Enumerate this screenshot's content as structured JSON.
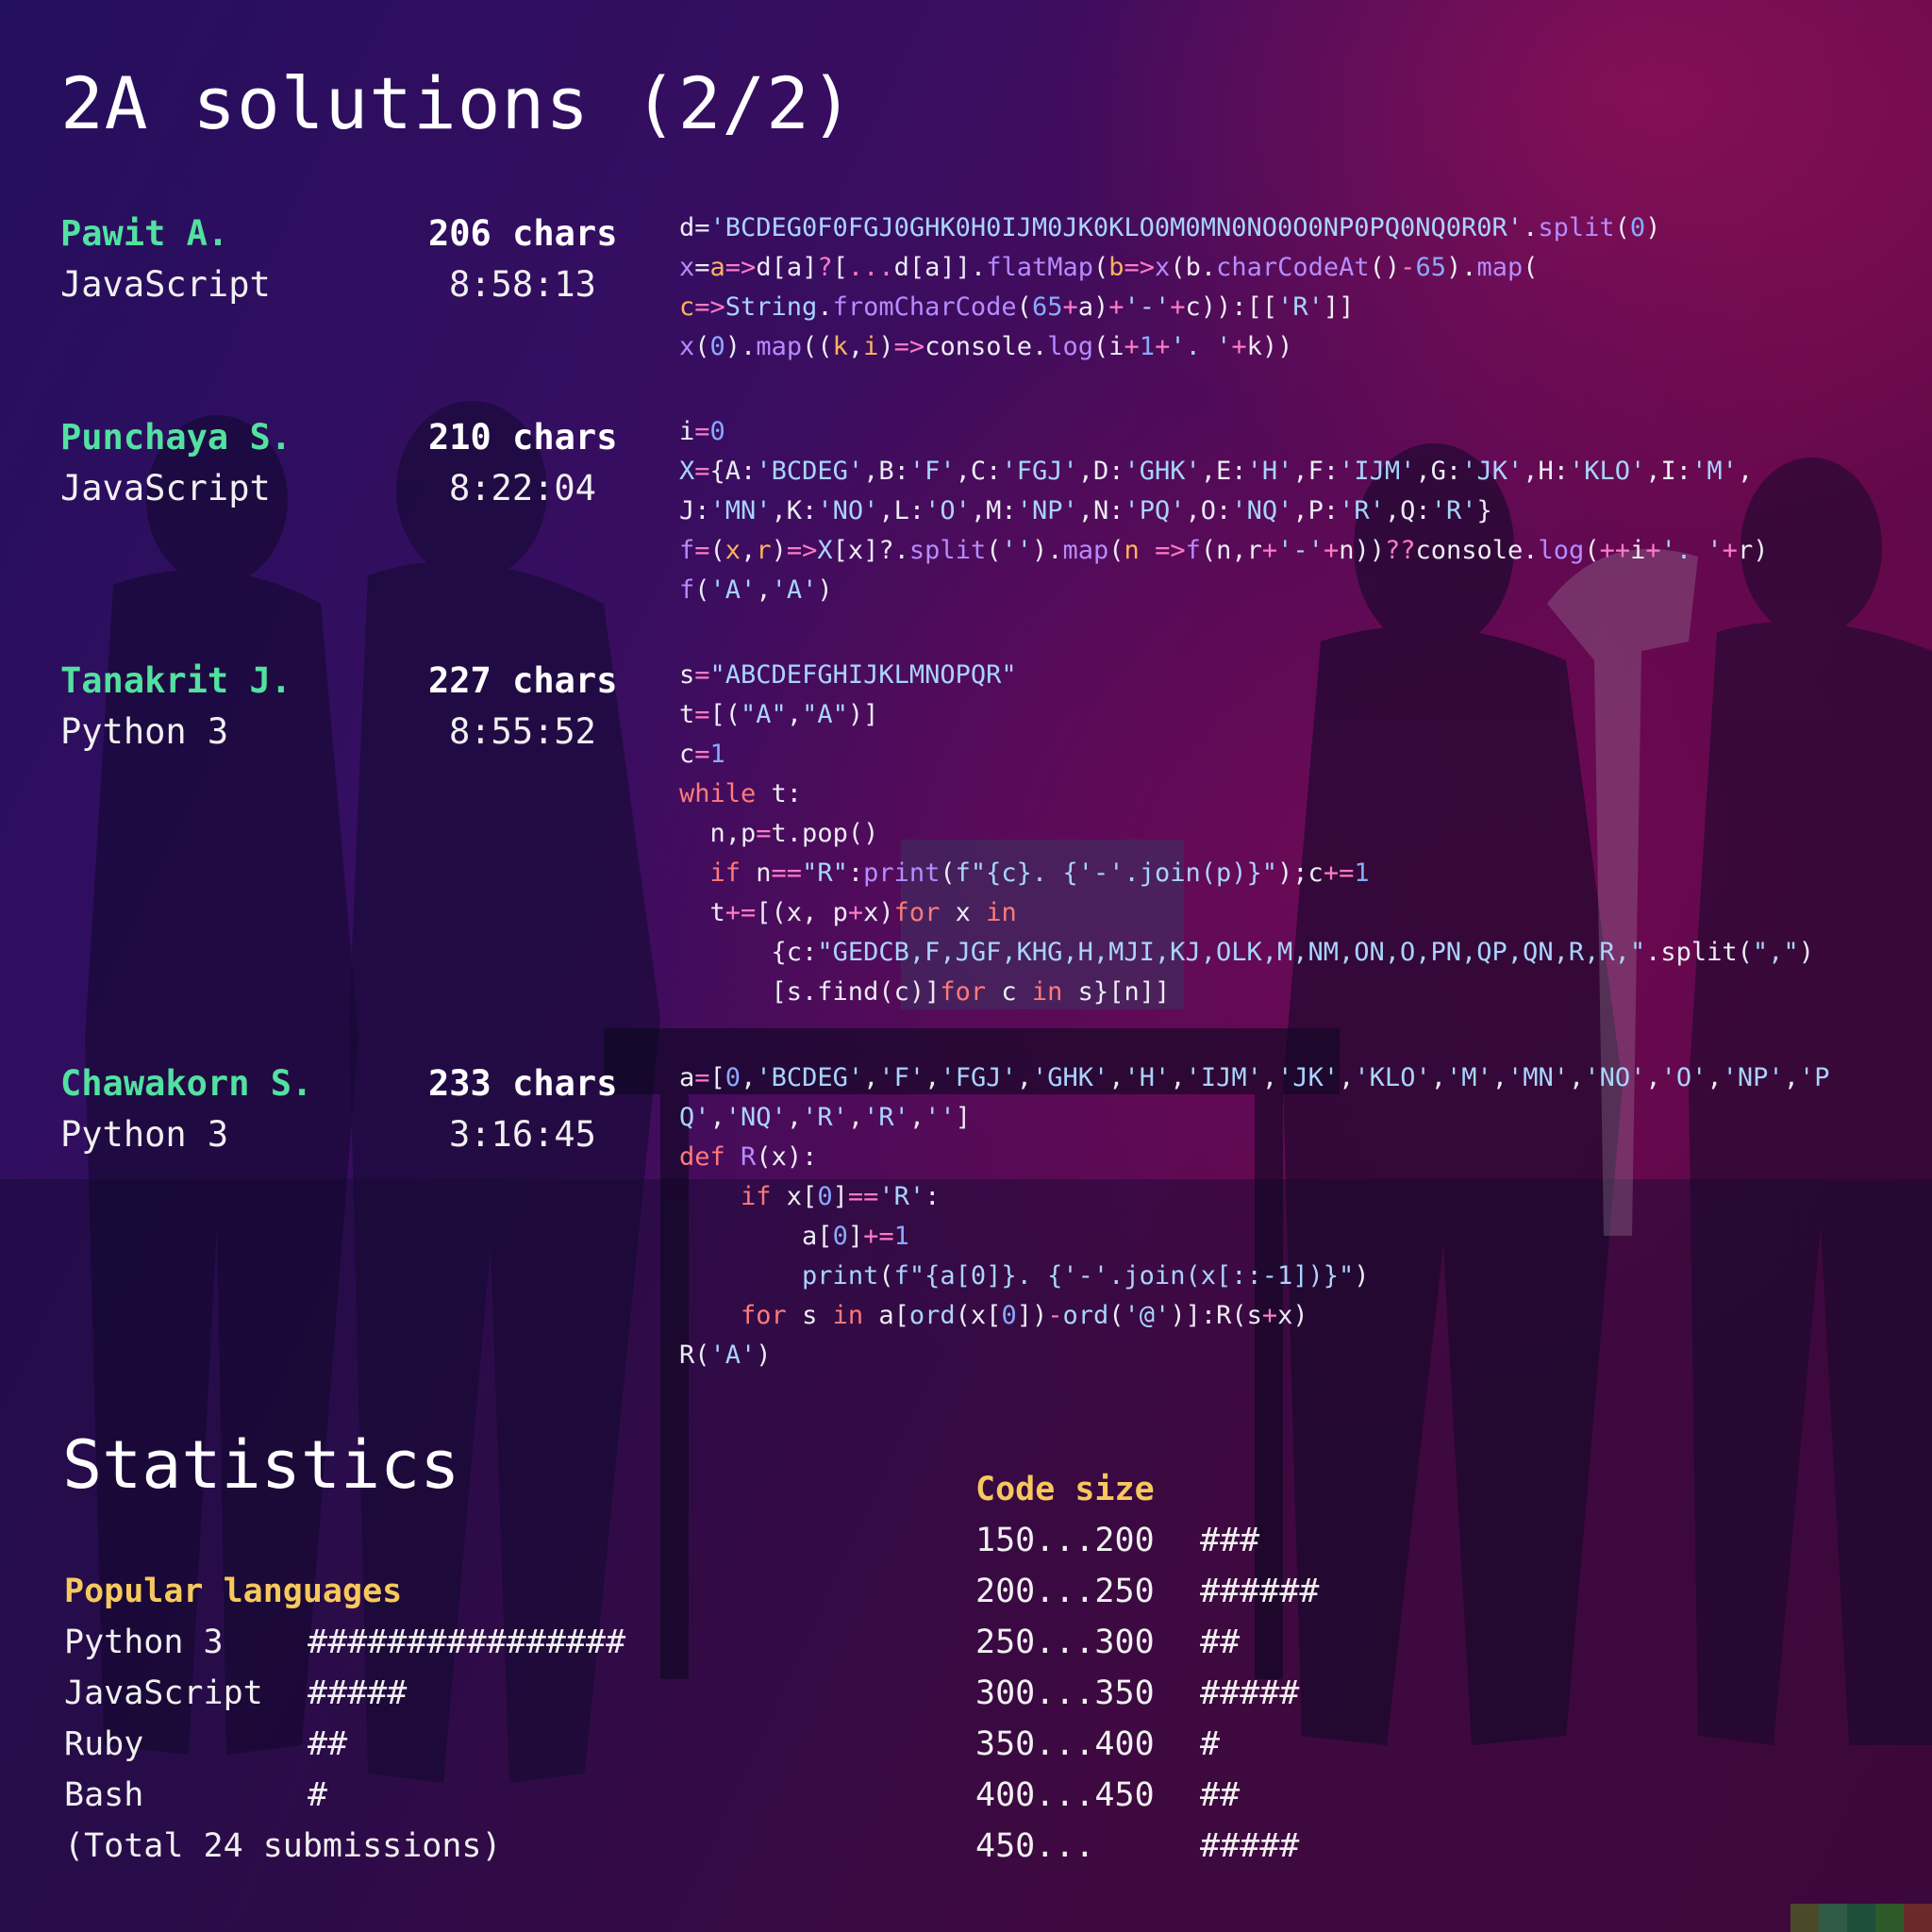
{
  "title": "2A solutions (2/2)",
  "entries": [
    {
      "name": "Pawit A.",
      "language": "JavaScript",
      "chars": "206 chars",
      "time": "8:58:13"
    },
    {
      "name": "Punchaya S.",
      "language": "JavaScript",
      "chars": "210 chars",
      "time": "8:22:04"
    },
    {
      "name": "Tanakrit J.",
      "language": "Python 3",
      "chars": "227 chars",
      "time": "8:55:52"
    },
    {
      "name": "Chawakorn S.",
      "language": "Python 3",
      "chars": "233 chars",
      "time": "3:16:45"
    }
  ],
  "code": {
    "pawit": [
      "d='BCDEG0F0FGJ0GHK0H0IJM0JK0KLO0M0MN0NO0O0NP0PQ0NQ0R0R'.split(0)",
      "x=a=>d[a]?[...d[a]].flatMap(b=>x(b.charCodeAt()-65).map(",
      "c=>String.fromCharCode(65+a)+'-'+c)):[['R']]",
      "x(0).map((k,i)=>console.log(i+1+'. '+k))"
    ],
    "punchaya": [
      "i=0",
      "X={A:'BCDEG',B:'F',C:'FGJ',D:'GHK',E:'H',F:'IJM',G:'JK',H:'KLO',I:'M',",
      "J:'MN',K:'NO',L:'O',M:'NP',N:'PQ',O:'NQ',P:'R',Q:'R'}",
      "f=(x,r)=>X[x]?.split('').map(n =>f(n,r+'-'+n))??console.log(++i+'. '+r)",
      "f('A','A')"
    ],
    "tanakrit": [
      "s=\"ABCDEFGHIJKLMNOPQR\"",
      "t=[(\"A\",\"A\")]",
      "c=1",
      "while t:",
      "  n,p=t.pop()",
      "  if n==\"R\":print(f\"{c}. {'-'.join(p)}\");c+=1",
      "  t+=[(x, p+x)for x in",
      "      {c:\"GEDCB,F,JGF,KHG,H,MJI,KJ,OLK,M,NM,ON,O,PN,QP,QN,R,R,\".split(\",\")",
      "      [s.find(c)]for c in s}[n]]"
    ],
    "chawakorn": [
      "a=[0,'BCDEG','F','FGJ','GHK','H','IJM','JK','KLO','M','MN','NO','O','NP','P",
      "Q','NQ','R','R','']",
      "def R(x):",
      "    if x[0]=='R':",
      "        a[0]+=1",
      "        print(f\"{a[0]}. {'-'.join(x[::-1])}\")",
      "    for s in a[ord(x[0])-ord('@')]:R(s+x)",
      "R('A')"
    ]
  },
  "statistics": {
    "title": "Statistics",
    "languages": {
      "heading": "Popular languages",
      "rows": [
        {
          "label": "Python 3",
          "bar": "################",
          "count": 16
        },
        {
          "label": "JavaScript",
          "bar": "#####",
          "count": 5
        },
        {
          "label": "Ruby",
          "bar": "##",
          "count": 2
        },
        {
          "label": "Bash",
          "bar": "#",
          "count": 1
        }
      ],
      "total": "(Total 24 submissions)"
    },
    "code_size": {
      "heading": "Code size",
      "rows": [
        {
          "label": "150...200",
          "bar": "###",
          "count": 3
        },
        {
          "label": "200...250",
          "bar": "######",
          "count": 6
        },
        {
          "label": "250...300",
          "bar": "##",
          "count": 2
        },
        {
          "label": "300...350",
          "bar": "#####",
          "count": 5
        },
        {
          "label": "350...400",
          "bar": "#",
          "count": 1
        },
        {
          "label": "400...450",
          "bar": "##",
          "count": 2
        },
        {
          "label": "450...",
          "bar": "#####",
          "count": 5
        }
      ]
    }
  },
  "colors": {
    "name": "#52e1a0",
    "heading": "#f7c85c",
    "keyword": "#ff7a7a",
    "string": "#a8d4ff",
    "number": "#88aaff",
    "function": "#b58cff"
  },
  "palette": [
    "#4a4a2a",
    "#2f5a46",
    "#1f4f3a",
    "#2e5a2a",
    "#6a2a2a"
  ]
}
